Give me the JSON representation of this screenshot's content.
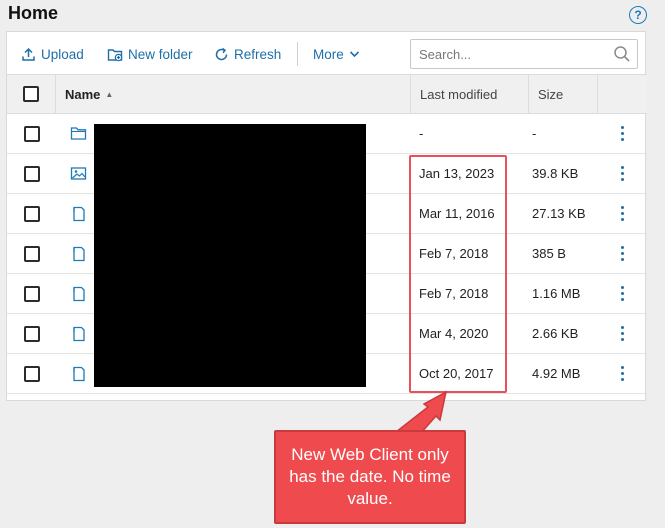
{
  "page": {
    "title": "Home",
    "help_glyph": "?"
  },
  "toolbar": {
    "upload_label": "Upload",
    "new_folder_label": "New folder",
    "refresh_label": "Refresh",
    "more_label": "More",
    "search_placeholder": "Search..."
  },
  "table": {
    "columns": {
      "name": "Name",
      "last_modified": "Last modified",
      "size": "Size"
    },
    "rows": [
      {
        "type": "folder",
        "last_modified": "-",
        "size": "-"
      },
      {
        "type": "image",
        "last_modified": "Jan 13, 2023",
        "size": "39.8 KB"
      },
      {
        "type": "file",
        "last_modified": "Mar 11, 2016",
        "size": "27.13 KB"
      },
      {
        "type": "file",
        "last_modified": "Feb 7, 2018",
        "size": "385 B"
      },
      {
        "type": "file",
        "last_modified": "Feb 7, 2018",
        "size": "1.16 MB"
      },
      {
        "type": "file",
        "last_modified": "Mar 4, 2020",
        "size": "2.66 KB"
      },
      {
        "type": "file",
        "last_modified": "Oct 20, 2017",
        "size": "4.92 MB"
      }
    ]
  },
  "annotation": {
    "text": "New Web Client only has the date. No time value.",
    "color": "#ef4a4d"
  },
  "colors": {
    "accent": "#1e6fa8",
    "icon": "#1e7ab8"
  }
}
